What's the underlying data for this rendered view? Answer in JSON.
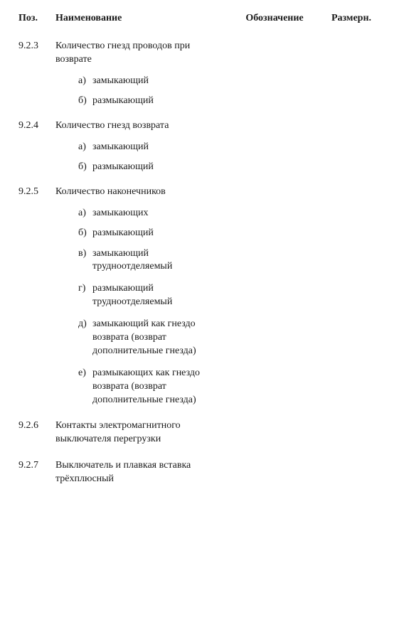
{
  "headers": {
    "number": "Поз.",
    "description": "Наименование",
    "value": "Обозначение",
    "reference": "Размерн."
  },
  "rows": [
    {
      "num": "9.2.3",
      "title": "Количество гнезд проводов при возврате",
      "subs": [
        {
          "letter": "а)",
          "text": "замыкающий"
        },
        {
          "letter": "б)",
          "text": "размыкающий"
        }
      ]
    },
    {
      "num": "9.2.4",
      "title": "Количество гнезд возврата",
      "subs": [
        {
          "letter": "а)",
          "text": "замыкающий"
        },
        {
          "letter": "б)",
          "text": "размыкающий"
        }
      ]
    },
    {
      "num": "9.2.5",
      "title": "Количество наконечников",
      "subs": [
        {
          "letter": "а)",
          "text": "замыкающих"
        },
        {
          "letter": "б)",
          "text": "размыкающий"
        },
        {
          "letter": "в)",
          "text": "замыкающий трудноотделяемый"
        },
        {
          "letter": "г)",
          "text": "размыкающий трудноотделяемый"
        },
        {
          "letter": "д)",
          "text": "замыкающий как гнездо возврата (возврат дополнительные гнезда)"
        },
        {
          "letter": "е)",
          "text": "размыкающих как гнездо возврата (возврат дополнительные гнезда)"
        }
      ]
    },
    {
      "num": "9.2.6",
      "title": "Контакты электромагнитного выключателя перегрузки"
    },
    {
      "num": "9.2.7",
      "title": "Выключатель и плавкая вставка трёхплюсный"
    }
  ]
}
